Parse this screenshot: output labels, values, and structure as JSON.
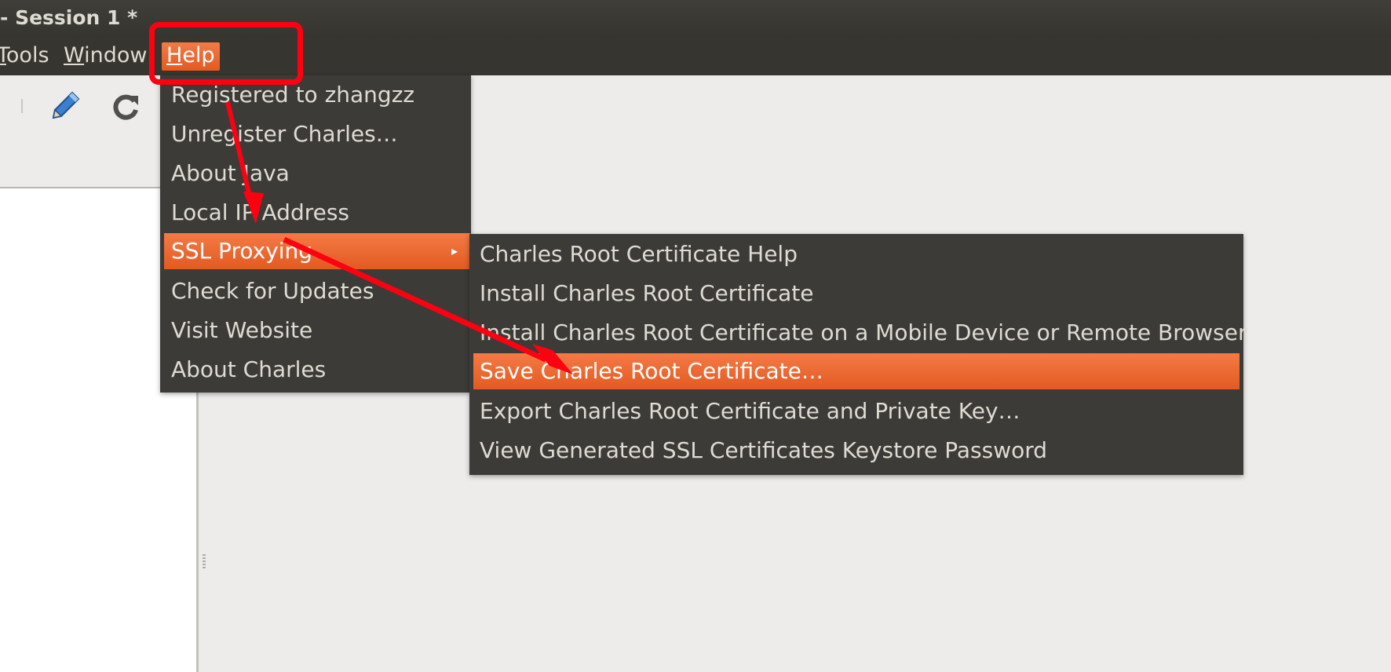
{
  "window": {
    "title": "- Session 1 *"
  },
  "menubar": {
    "tools": {
      "pre": "",
      "acc": "T",
      "post": "ools"
    },
    "window": {
      "pre": "",
      "acc": "W",
      "post": "indow"
    },
    "help": {
      "pre": "",
      "acc": "H",
      "post": "elp"
    }
  },
  "toolbar": {
    "icons": [
      "pencil-icon",
      "reload-icon"
    ]
  },
  "help_menu": {
    "items": [
      {
        "label": "Registered to zhangzz"
      },
      {
        "label": "Unregister Charles…"
      },
      {
        "label": "About Java"
      },
      {
        "label": "Local IP Address"
      },
      {
        "label": "SSL Proxying",
        "submenu": true
      },
      {
        "label": "Check for Updates"
      },
      {
        "label": "Visit Website"
      },
      {
        "label": "About Charles"
      }
    ],
    "active_index": 4
  },
  "ssl_submenu": {
    "items": [
      {
        "label": "Charles Root Certificate Help"
      },
      {
        "label": "Install Charles Root Certificate"
      },
      {
        "label": "Install Charles Root Certificate on a Mobile Device or Remote Browser"
      },
      {
        "label": "Save Charles Root Certificate…"
      },
      {
        "label": "Export Charles Root Certificate and Private Key…"
      },
      {
        "label": "View Generated SSL Certificates Keystore Password"
      }
    ],
    "active_index": 3
  },
  "colors": {
    "menu_bg": "#3c3b37",
    "highlight": "#e9642b",
    "annotation": "#ff0011",
    "workspace": "#edecea"
  }
}
